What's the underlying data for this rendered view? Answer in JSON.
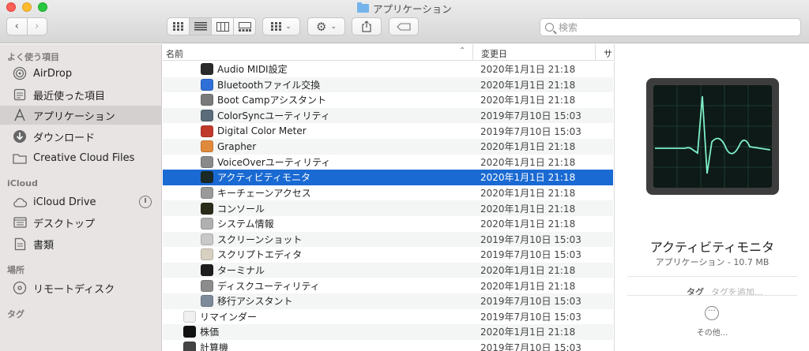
{
  "window": {
    "title": "アプリケーション"
  },
  "toolbar": {
    "back": "‹",
    "forward": "›",
    "search_placeholder": "検索"
  },
  "sidebar": {
    "favorites_header": "よく使う項目",
    "favorites": [
      {
        "label": "AirDrop",
        "icon": "airdrop-icon"
      },
      {
        "label": "最近使った項目",
        "icon": "recents-icon"
      },
      {
        "label": "アプリケーション",
        "icon": "applications-icon",
        "selected": true
      },
      {
        "label": "ダウンロード",
        "icon": "downloads-icon"
      },
      {
        "label": "Creative Cloud Files",
        "icon": "folder-icon"
      }
    ],
    "icloud_header": "iCloud",
    "icloud": [
      {
        "label": "iCloud Drive",
        "icon": "cloud-icon"
      },
      {
        "label": "デスクトップ",
        "icon": "desktop-icon"
      },
      {
        "label": "書類",
        "icon": "document-icon"
      }
    ],
    "locations_header": "場所",
    "locations": [
      {
        "label": "リモートディスク",
        "icon": "disc-icon"
      }
    ],
    "tags_header": "タグ"
  },
  "list": {
    "col_name": "名前",
    "col_date": "変更日",
    "col_size": "サ",
    "rows": [
      {
        "name": "Audio MIDI設定",
        "date": "2020年1月1日 21:18",
        "indent": 1,
        "color": "#2a2a2a"
      },
      {
        "name": "Bluetoothファイル交換",
        "date": "2020年1月1日 21:18",
        "indent": 1,
        "color": "#2f6fd8"
      },
      {
        "name": "Boot Campアシスタント",
        "date": "2020年1月1日 21:18",
        "indent": 1,
        "color": "#7a7a7a"
      },
      {
        "name": "ColorSyncユーティリティ",
        "date": "2019年7月10日 15:03",
        "indent": 1,
        "color": "#5a6b7a"
      },
      {
        "name": "Digital Color Meter",
        "date": "2019年7月10日 15:03",
        "indent": 1,
        "color": "#c0392b"
      },
      {
        "name": "Grapher",
        "date": "2020年1月1日 21:18",
        "indent": 1,
        "color": "#e08a3c"
      },
      {
        "name": "VoiceOverユーティリティ",
        "date": "2020年1月1日 21:18",
        "indent": 1,
        "color": "#8a8a8a"
      },
      {
        "name": "アクティビティモニタ",
        "date": "2020年1月1日 21:18",
        "indent": 1,
        "color": "#1b2a26",
        "selected": true
      },
      {
        "name": "キーチェーンアクセス",
        "date": "2020年1月1日 21:18",
        "indent": 1,
        "color": "#9a9a9a"
      },
      {
        "name": "コンソール",
        "date": "2020年1月1日 21:18",
        "indent": 1,
        "color": "#2b2b1a"
      },
      {
        "name": "システム情報",
        "date": "2020年1月1日 21:18",
        "indent": 1,
        "color": "#b0b0b0"
      },
      {
        "name": "スクリーンショット",
        "date": "2019年7月10日 15:03",
        "indent": 1,
        "color": "#c8c8c8"
      },
      {
        "name": "スクリプトエディタ",
        "date": "2019年7月10日 15:03",
        "indent": 1,
        "color": "#d8d0c0"
      },
      {
        "name": "ターミナル",
        "date": "2020年1月1日 21:18",
        "indent": 1,
        "color": "#1e1e1e"
      },
      {
        "name": "ディスクユーティリティ",
        "date": "2020年1月1日 21:18",
        "indent": 1,
        "color": "#8c8c8c"
      },
      {
        "name": "移行アシスタント",
        "date": "2019年7月10日 15:03",
        "indent": 1,
        "color": "#7c8a9a"
      },
      {
        "name": "リマインダー",
        "date": "2019年7月10日 15:03",
        "indent": 0,
        "color": "#f0f0f0"
      },
      {
        "name": "株価",
        "date": "2020年1月1日 21:18",
        "indent": 0,
        "color": "#111111"
      },
      {
        "name": "計算機",
        "date": "2019年7月10日 15:03",
        "indent": 0,
        "color": "#444444"
      }
    ]
  },
  "preview": {
    "title": "アクティビティモニタ",
    "subtitle": "アプリケーション - 10.7 MB",
    "tag_label": "タグ",
    "tag_placeholder": "タグを追加...",
    "more_label": "その他..."
  }
}
